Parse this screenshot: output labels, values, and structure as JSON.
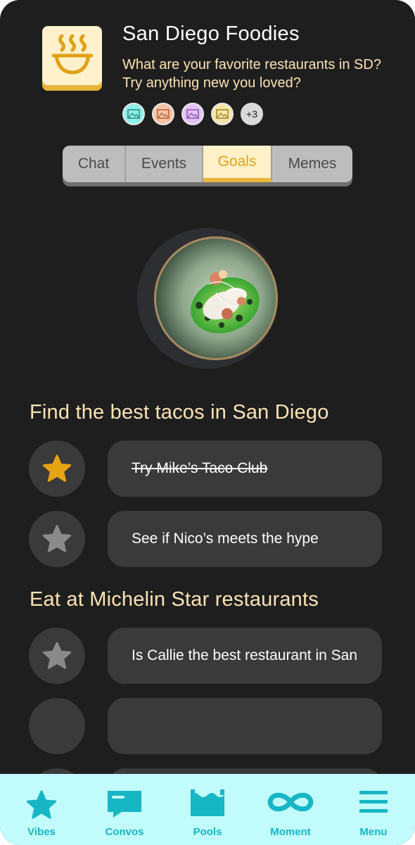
{
  "group": {
    "name": "San Diego Foodies",
    "description": "What are your favorite restaurants in SD? Try anything new you loved?",
    "icon": "soup-bowl-icon",
    "members_more": "+3",
    "avatar_colors": [
      "#8ff0e8",
      "#f6c3a5",
      "#e6c3f7",
      "#f3e6a8"
    ]
  },
  "tabs": [
    {
      "label": "Chat"
    },
    {
      "label": "Events"
    },
    {
      "label": "Goals",
      "active": true
    },
    {
      "label": "Memes"
    }
  ],
  "goals": [
    {
      "title": "Find the best tacos in San Diego",
      "items": [
        {
          "text": "Try Mike’s Taco Club",
          "done": true
        },
        {
          "text": "See if Nico’s meets the hype",
          "done": false
        }
      ]
    },
    {
      "title": "Eat at Michelin Star restaurants",
      "items": [
        {
          "text": "Is Callie the best restaurant in San",
          "done": false
        },
        {
          "text": "",
          "done": false
        }
      ]
    }
  ],
  "nav": [
    {
      "label": "Vibes",
      "icon": "star-icon"
    },
    {
      "label": "Convos",
      "icon": "chat-bubble-icon"
    },
    {
      "label": "Pools",
      "icon": "pool-icon"
    },
    {
      "label": "Moment",
      "icon": "infinity-icon"
    },
    {
      "label": "Menu",
      "icon": "menu-icon"
    }
  ],
  "colors": {
    "background": "#1e1e1e",
    "accent_gold": "#e7b53a",
    "cream": "#fbe3b4",
    "teal": "#16b6c4",
    "nav_bg": "#c2fbfb"
  }
}
